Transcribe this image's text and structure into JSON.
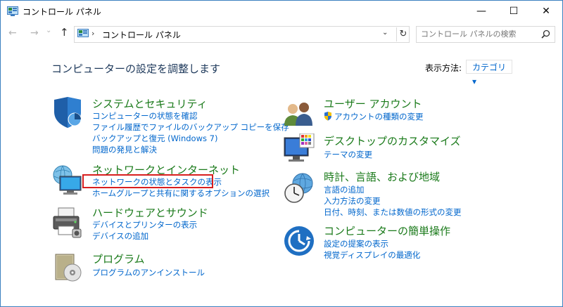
{
  "window": {
    "title": "コントロール パネル",
    "min_glyph": "—",
    "max_glyph": "☐",
    "close_glyph": "✕"
  },
  "nav": {
    "back_glyph": "←",
    "forward_glyph": "→",
    "recent_glyph": "⌄",
    "up_glyph": "↑",
    "separator": "›",
    "breadcrumb": "コントロール パネル",
    "dropdown_glyph": "⌄",
    "refresh_glyph": "↻",
    "search_placeholder": "コントロール パネルの検索"
  },
  "page": {
    "heading": "コンピューターの設定を調整します",
    "view_by_label": "表示方法:",
    "view_by_value": "カテゴリ ▾"
  },
  "categories": {
    "system": {
      "icon": "shield-icon",
      "title": "システムとセキュリティ",
      "links": [
        "コンピューターの状態を確認",
        "ファイル履歴でファイルのバックアップ コピーを保存",
        "バックアップと復元 (Windows 7)",
        "問題の発見と解決"
      ]
    },
    "network": {
      "icon": "network-globe-icon",
      "title": "ネットワークとインターネット",
      "links": [
        "ネットワークの状態とタスクの表示",
        "ホームグループと共有に関するオプションの選択"
      ]
    },
    "hardware": {
      "icon": "printer-icon",
      "title": "ハードウェアとサウンド",
      "links": [
        "デバイスとプリンターの表示",
        "デバイスの追加"
      ]
    },
    "programs": {
      "icon": "programs-disc-icon",
      "title": "プログラム",
      "links": [
        "プログラムのアンインストール"
      ]
    },
    "users": {
      "icon": "users-icon",
      "title": "ユーザー アカウント",
      "links": [
        "アカウントの種類の変更"
      ]
    },
    "desktop": {
      "icon": "desktop-monitor-icon",
      "title": "デスクトップのカスタマイズ",
      "links": [
        "テーマの変更"
      ]
    },
    "clock": {
      "icon": "clock-globe-icon",
      "title": "時計、言語、および地域",
      "links": [
        "言語の追加",
        "入力方法の変更",
        "日付、時刻、または数値の形式の変更"
      ]
    },
    "ease": {
      "icon": "ease-of-access-icon",
      "title": "コンピューターの簡単操作",
      "links": [
        "設定の提案の表示",
        "視覚ディスプレイの最適化"
      ]
    }
  },
  "colors": {
    "category_title": "#1a7a1a",
    "link": "#0066cc",
    "highlight_border": "#d81e1e",
    "heading": "#1e395b"
  }
}
